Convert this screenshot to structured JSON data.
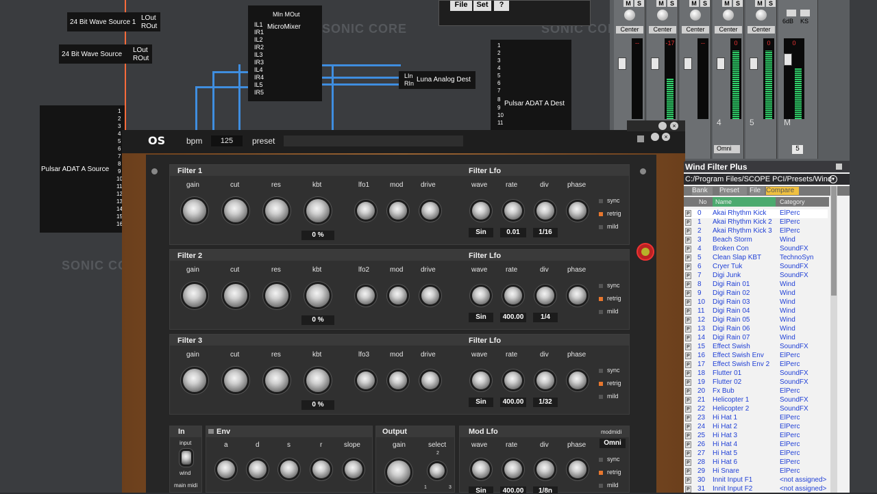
{
  "routing": {
    "wave_source_1": {
      "name": "24 Bit Wave Source 1",
      "outs": [
        "LOut",
        "ROut"
      ]
    },
    "wave_source_2": {
      "name": "24 Bit Wave Source",
      "outs": [
        "LOut",
        "ROut"
      ]
    },
    "micromixer": {
      "name": "MicroMixer",
      "top_ports": "MIn MOut",
      "inputs": [
        "IL1",
        "IR1",
        "IL2",
        "IR2",
        "IL3",
        "IR3",
        "IL4",
        "IR4",
        "IL5",
        "IR5"
      ]
    },
    "luna_dest": {
      "name": "Luna Analog Dest",
      "ins": [
        "LIn",
        "RIn"
      ]
    },
    "adat_dest": {
      "name": "Pulsar ADAT A Dest",
      "ports": [
        "1",
        "2",
        "3",
        "4",
        "5",
        "6",
        "7",
        "8",
        "9",
        "10",
        "11"
      ]
    },
    "adat_source": {
      "name": "Pulsar ADAT A Source",
      "ports": [
        "1",
        "2",
        "3",
        "4",
        "5",
        "6",
        "7",
        "8",
        "9",
        "10",
        "11",
        "12",
        "13",
        "14",
        "15",
        "16"
      ]
    },
    "watermark": "SONIC CORE",
    "menu": {
      "file": "File",
      "set": "Set",
      "help": "?"
    }
  },
  "mixer": {
    "channels": [
      {
        "peak": "--",
        "label": ""
      },
      {
        "peak": "-17",
        "label": ""
      },
      {
        "peak": "--",
        "label": ""
      },
      {
        "peak": "0",
        "label": "4"
      },
      {
        "peak": "0",
        "label": "5"
      }
    ],
    "pan_label": "Center",
    "master": {
      "label": "M",
      "db": "6dB",
      "ks": "KS",
      "peak": "0",
      "value": "5"
    },
    "omni": "Omni"
  },
  "plugin": {
    "logo": "OS",
    "bpm_label": "bpm",
    "bpm_value": "125",
    "preset_label": "preset",
    "filters": [
      {
        "title": "Filter 1",
        "lfo_title": "Filter Lfo",
        "lfo_label": "lfo1",
        "kbt": "0 %",
        "wave": "Sin",
        "rate": "0.01",
        "div": "1/16"
      },
      {
        "title": "Filter 2",
        "lfo_title": "Filter Lfo",
        "lfo_label": "lfo2",
        "kbt": "0 %",
        "wave": "Sin",
        "rate": "400.00",
        "div": "1/4"
      },
      {
        "title": "Filter 3",
        "lfo_title": "Filter Lfo",
        "lfo_label": "lfo3",
        "kbt": "0 %",
        "wave": "Sin",
        "rate": "400.00",
        "div": "1/32"
      }
    ],
    "knob_labels": {
      "gain": "gain",
      "cut": "cut",
      "res": "res",
      "kbt": "kbt",
      "mod": "mod",
      "drive": "drive",
      "wave": "wave",
      "rate": "rate",
      "div": "div",
      "phase": "phase"
    },
    "toggles": {
      "sync": "sync",
      "retrig": "retrig",
      "mild": "mild"
    },
    "bottom": {
      "in_title": "In",
      "input_label": "input",
      "wind_label": "wind",
      "main_midi": "main midi",
      "env_title": "Env",
      "env_labels": [
        "a",
        "d",
        "s",
        "r",
        "slope"
      ],
      "output_title": "Output",
      "out_gain": "gain",
      "out_select": "select",
      "sel_marks": [
        "1",
        "2",
        "3"
      ],
      "modlfo_title": "Mod Lfo",
      "modmidi_label": "modmidi",
      "omni": "Omni",
      "mod_wave": "Sin",
      "mod_rate": "400.00",
      "mod_div": "1/8n"
    }
  },
  "preset_list": {
    "title": "Wind Filter Plus",
    "path": "C:/Program Files/SCOPE PCI/Presets/Wind",
    "tabs": [
      "Bank",
      "Preset",
      "File",
      "Compare"
    ],
    "columns": [
      "No",
      "Name",
      "Category"
    ],
    "rows": [
      {
        "no": "0",
        "name": "Akai Rhythm Kick",
        "cat": "ElPerc"
      },
      {
        "no": "1",
        "name": "Akai Rhythm Kick 2",
        "cat": "ElPerc"
      },
      {
        "no": "2",
        "name": "Akai Rhythm Kick 3",
        "cat": "ElPerc"
      },
      {
        "no": "3",
        "name": "Beach Storm",
        "cat": "Wind"
      },
      {
        "no": "4",
        "name": "Broken Con",
        "cat": "SoundFX"
      },
      {
        "no": "5",
        "name": "Clean Slap KBT",
        "cat": "TechnoSyn"
      },
      {
        "no": "6",
        "name": "Cryer Tuk",
        "cat": "SoundFX"
      },
      {
        "no": "7",
        "name": "Digi Junk",
        "cat": "SoundFX"
      },
      {
        "no": "8",
        "name": "Digi Rain 01",
        "cat": "Wind"
      },
      {
        "no": "9",
        "name": "Digi Rain 02",
        "cat": "Wind"
      },
      {
        "no": "10",
        "name": "Digi Rain 03",
        "cat": "Wind"
      },
      {
        "no": "11",
        "name": "Digi Rain 04",
        "cat": "Wind"
      },
      {
        "no": "12",
        "name": "Digi Rain 05",
        "cat": "Wind"
      },
      {
        "no": "13",
        "name": "Digi Rain 06",
        "cat": "Wind"
      },
      {
        "no": "14",
        "name": "Digi Rain 07",
        "cat": "Wind"
      },
      {
        "no": "15",
        "name": "Effect Swish",
        "cat": "SoundFX"
      },
      {
        "no": "16",
        "name": "Effect Swish Env",
        "cat": "ElPerc"
      },
      {
        "no": "17",
        "name": "Effect Swish Env 2",
        "cat": "ElPerc"
      },
      {
        "no": "18",
        "name": "Flutter 01",
        "cat": "SoundFX"
      },
      {
        "no": "19",
        "name": "Flutter 02",
        "cat": "SoundFX"
      },
      {
        "no": "20",
        "name": "Fx Bub",
        "cat": "ElPerc"
      },
      {
        "no": "21",
        "name": "Helicopter 1",
        "cat": "SoundFX"
      },
      {
        "no": "22",
        "name": "Helicopter 2",
        "cat": "SoundFX"
      },
      {
        "no": "23",
        "name": "Hi Hat 1",
        "cat": "ElPerc"
      },
      {
        "no": "24",
        "name": "Hi Hat 2",
        "cat": "ElPerc"
      },
      {
        "no": "25",
        "name": "Hi Hat 3",
        "cat": "ElPerc"
      },
      {
        "no": "26",
        "name": "Hi Hat 4",
        "cat": "ElPerc"
      },
      {
        "no": "27",
        "name": "Hi Hat 5",
        "cat": "ElPerc"
      },
      {
        "no": "28",
        "name": "Hi Hat 6",
        "cat": "ElPerc"
      },
      {
        "no": "29",
        "name": "Hi Snare",
        "cat": "ElPerc"
      },
      {
        "no": "30",
        "name": "Innit Input F1",
        "cat": "<not assigned>"
      },
      {
        "no": "31",
        "name": "Innit Input F2",
        "cat": "<not assigned>"
      }
    ]
  },
  "colors": {
    "wire": "#3f8ee0",
    "meter": "#2fd36a",
    "led_on": "#e8772e",
    "list_text": "#1f3fd6",
    "compare_tab": "#f0c040"
  }
}
